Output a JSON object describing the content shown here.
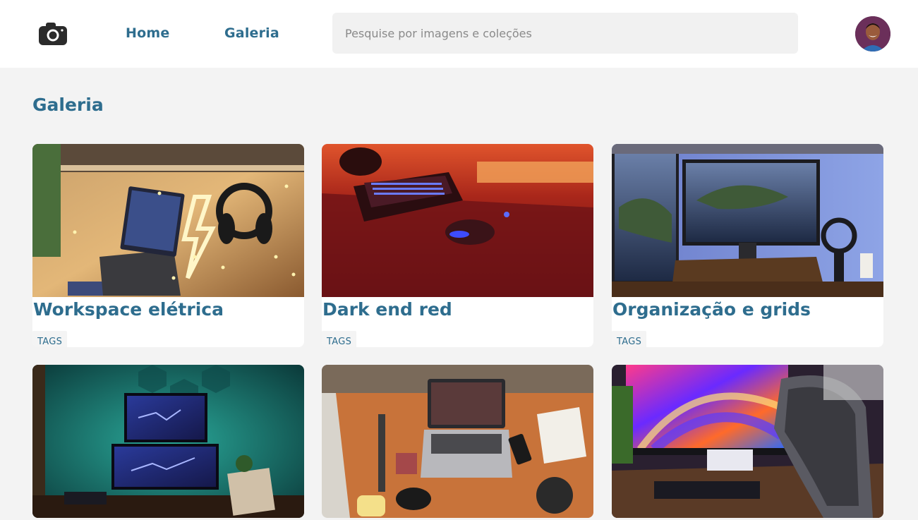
{
  "header": {
    "logo_icon": "camera-icon",
    "nav": [
      {
        "label": "Home"
      },
      {
        "label": "Galeria"
      }
    ],
    "search": {
      "placeholder": "Pesquise por imagens e coleções",
      "value": ""
    },
    "avatar_icon": "user-avatar"
  },
  "main": {
    "title": "Galeria",
    "cards": [
      {
        "title": "Workspace elétrica",
        "tag": "TAGS",
        "image": "desk-with-neon-lightning-and-headphones"
      },
      {
        "title": "Dark end red",
        "tag": "TAGS",
        "image": "red-lit-keyboard-and-mouse"
      },
      {
        "title": "Organização e grids",
        "tag": "TAGS",
        "image": "dual-monitors-with-island-wallpaper"
      },
      {
        "title": "",
        "tag": "",
        "image": "stacked-monitors-with-teal-lights"
      },
      {
        "title": "",
        "tag": "",
        "image": "laptop-on-orange-desk-mat"
      },
      {
        "title": "",
        "tag": "",
        "image": "colorful-monitor-and-mesh-chair"
      }
    ]
  },
  "colors": {
    "accent": "#2e6d8e",
    "background": "#f3f3f3",
    "surface": "#ffffff"
  }
}
